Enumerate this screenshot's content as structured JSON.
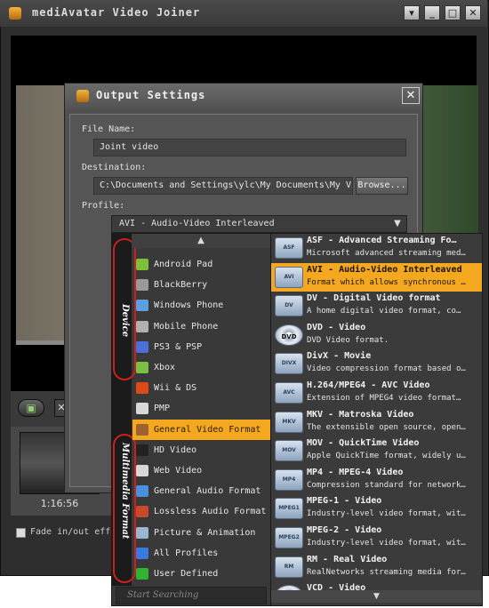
{
  "app": {
    "title": "mediAvatar Video Joiner",
    "window_buttons": [
      "▾",
      "_",
      "□",
      "✕"
    ]
  },
  "clip": {
    "duration": "1:16:56"
  },
  "options": {
    "fade_label": "Fade in/out effe"
  },
  "dialog": {
    "title": "Output Settings",
    "close": "✕",
    "file_name_label": "File Name:",
    "file_name_value": "Joint video",
    "destination_label": "Destination:",
    "destination_value": "C:\\Documents and Settings\\ylc\\My Documents\\My Video",
    "browse_label": "Browse...",
    "profile_label": "Profile:",
    "profile_value": "AVI - Audio-Video Interleaved"
  },
  "categories": {
    "device_label": "Device",
    "multimedia_label": "Multimedia Format",
    "search_placeholder": "Start Searching",
    "items": [
      {
        "label": "Android Pad",
        "icon": "android-icon",
        "color": "#7bbf3a"
      },
      {
        "label": "BlackBerry",
        "icon": "blackberry-icon",
        "color": "#9a9a9a"
      },
      {
        "label": "Windows Phone",
        "icon": "windows-icon",
        "color": "#5aa0e0"
      },
      {
        "label": "Mobile Phone",
        "icon": "mobile-phone-icon",
        "color": "#b0b0b0"
      },
      {
        "label": "PS3 & PSP",
        "icon": "psp-icon",
        "color": "#4a6fd8"
      },
      {
        "label": "Xbox",
        "icon": "xbox-icon",
        "color": "#7ac143"
      },
      {
        "label": "Wii & DS",
        "icon": "wii-icon",
        "color": "#e04a1a"
      },
      {
        "label": "PMP",
        "icon": "pmp-icon",
        "color": "#d8d8d8"
      },
      {
        "label": "General Video Format",
        "icon": "film-icon",
        "color": "#a06030",
        "selected": true
      },
      {
        "label": "HD Video",
        "icon": "hd-icon",
        "color": "#222222"
      },
      {
        "label": "Web Video",
        "icon": "web-video-icon",
        "color": "#d8d8d8"
      },
      {
        "label": "General Audio Format",
        "icon": "audio-icon",
        "color": "#4a90e0"
      },
      {
        "label": "Lossless Audio Format",
        "icon": "lossless-audio-icon",
        "color": "#c84a2a"
      },
      {
        "label": "Picture & Animation",
        "icon": "picture-icon",
        "color": "#9ab6d0"
      },
      {
        "label": "All Profiles",
        "icon": "all-profiles-icon",
        "color": "#3a7ae0"
      },
      {
        "label": "User Defined",
        "icon": "user-defined-icon",
        "color": "#2fb52f"
      }
    ]
  },
  "formats": [
    {
      "name": "ASF - Advanced Streaming Fo…",
      "desc": "Microsoft advanced streaming med…",
      "badge": "ASF"
    },
    {
      "name": "AVI - Audio-Video Interleaved",
      "desc": "Format which allows synchronous …",
      "badge": "AVI",
      "selected": true
    },
    {
      "name": "DV - Digital Video format",
      "desc": "A home digital video format, co…",
      "badge": "DV"
    },
    {
      "name": "DVD - Video",
      "desc": "DVD Video format.",
      "badge": "DVD",
      "disc": true
    },
    {
      "name": "DivX - Movie",
      "desc": "Video compression format based o…",
      "badge": "DIVX"
    },
    {
      "name": "H.264/MPEG4 - AVC Video",
      "desc": "Extension of MPEG4 video format…",
      "badge": "AVC"
    },
    {
      "name": "MKV - Matroska Video",
      "desc": "The extensible open source, open…",
      "badge": "MKV"
    },
    {
      "name": "MOV - QuickTime Video",
      "desc": "Apple QuickTime format, widely u…",
      "badge": "MOV"
    },
    {
      "name": "MP4 - MPEG-4 Video",
      "desc": "Compression standard for network…",
      "badge": "MP4"
    },
    {
      "name": "MPEG-1 - Video",
      "desc": "Industry-level video format, wit…",
      "badge": "MPEG1"
    },
    {
      "name": "MPEG-2 - Video",
      "desc": "Industry-level video format, wit…",
      "badge": "MPEG2"
    },
    {
      "name": "RM - Real Video",
      "desc": "RealNetworks streaming media for…",
      "badge": "RM"
    },
    {
      "name": "VCD - Video",
      "desc": "",
      "badge": "VCD",
      "disc": true
    }
  ]
}
